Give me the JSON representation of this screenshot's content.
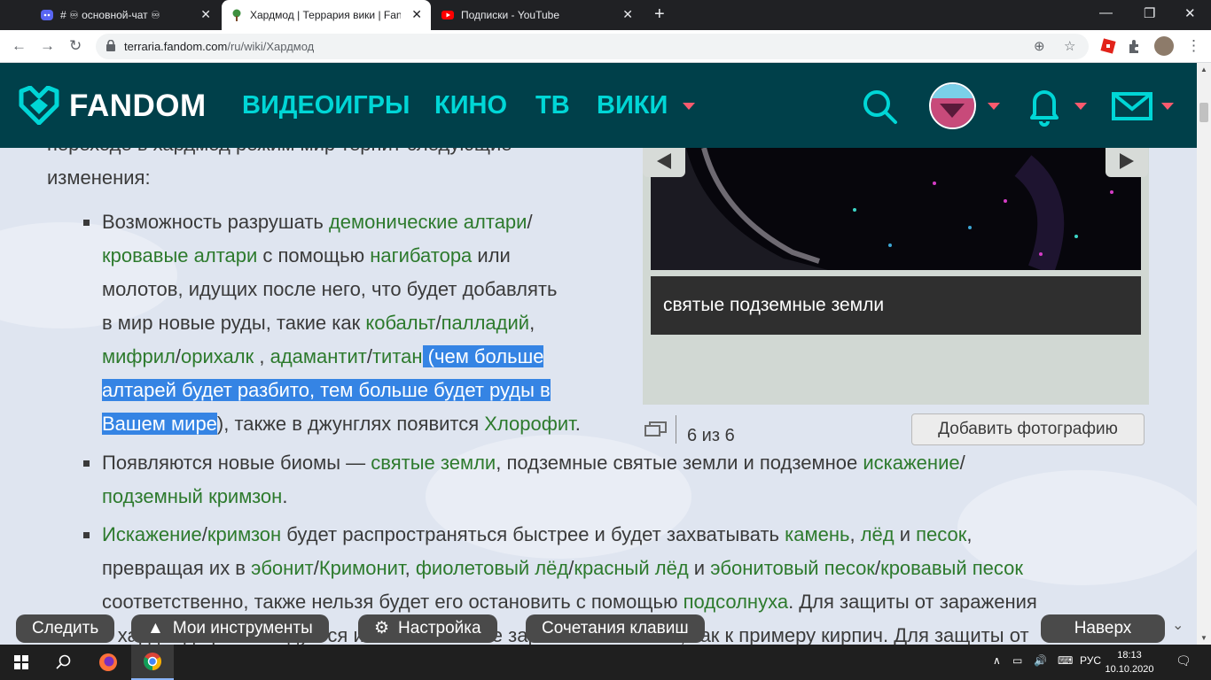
{
  "browser": {
    "tabs": [
      {
        "title": "# ♾ основной-чат ♾",
        "icon": "discord-icon"
      },
      {
        "title": "Хардмод | Террария вики | Fandom",
        "icon": "terraria-tree-icon"
      },
      {
        "title": "Подписки - YouTube",
        "icon": "youtube-icon"
      }
    ],
    "url_host": "terraria.fandom.com",
    "url_path": "/ru/wiki/Хардмод"
  },
  "fandom_header": {
    "logo": "FANDOM",
    "nav": [
      "ВИДЕОИГРЫ",
      "КИНО",
      "ТВ",
      "ВИКИ"
    ],
    "accent_color": "#00d6d6",
    "bg_color": "#00404a"
  },
  "article": {
    "intro_line1": "переходе в хардмод режим мир терпит следующие",
    "intro_line2": "изменения:",
    "b1": {
      "l1_a": "Возможность разрушать ",
      "l1_link": "демонические алтари",
      "l1_b": "/",
      "l2_link1": "кровавые алтари",
      "l2_a": " с помощью ",
      "l2_link2": "нагибатора",
      "l2_b": " или",
      "l3": "молотов, идущих после него, что будет добавлять",
      "l4_a": "в мир новые руды, такие как ",
      "l4_link1": "кобальт",
      "l4_b": "/",
      "l4_link2": "палладий",
      "l4_c": ",",
      "l5_link1": "мифрил",
      "l5_a": "/",
      "l5_link2": "орихалк",
      "l5_b": " , ",
      "l5_link3": "адамантит",
      "l5_c": "/",
      "l5_link4": "титан",
      "l5_sel": " (чем больше",
      "l6_sel": "алтарей будет разбито, тем больше будет руды в",
      "l7_sel": "Вашем мире",
      "l7_a": "), также в джунглях появится ",
      "l7_link": "Хлорофит",
      "l7_b": "."
    },
    "b2": {
      "l1_a": "Появляются новые биомы — ",
      "l1_link1": "святые земли",
      "l1_b": ", подземные святые земли и подземное ",
      "l1_link2": "искажение",
      "l1_c": "/",
      "l2_link": "подземный кримзон",
      "l2_a": "."
    },
    "b3": {
      "l1_link1": "Искажение",
      "l1_a": "/",
      "l1_link2": "кримзон",
      "l1_b": " будет распространяться быстрее и будет захватывать ",
      "l1_link3": "камень",
      "l1_c": ", ",
      "l1_link4": "лёд",
      "l1_d": " и ",
      "l1_link5": "песок",
      "l1_e": ",",
      "l2_a": "превращая их в ",
      "l2_link1": "эбонит",
      "l2_b": "/",
      "l2_link2": "Кримонит",
      "l2_c": ", ",
      "l2_link3": "фиолетовый лёд",
      "l2_d": "/",
      "l2_link4": "красный лёд",
      "l2_e": " и ",
      "l2_link5": "эбонитовый песок",
      "l2_f": "/",
      "l2_link6": "кровавый песок",
      "l3_a": "соответственно, также нельзя будет его остановить с помощью ",
      "l3_link": "подсолнуха",
      "l3_b": ". Для защиты от заражения",
      "l4": "в хардмоде рекомендуется использовать не заражаемые блоки, как к примеру кирпич. Для защиты от"
    }
  },
  "gallery": {
    "caption": "святые подземные земли",
    "counter": "6 из 6",
    "add_photo": "Добавить фотографию"
  },
  "wiki_toolbar": {
    "follow": "Следить",
    "my_tools": "Мои инструменты",
    "settings": "Настройка",
    "shortcuts": "Сочетания клавиш",
    "to_top": "Наверх"
  },
  "taskbar": {
    "lang": "РУС",
    "time": "18:13",
    "date": "10.10.2020"
  }
}
